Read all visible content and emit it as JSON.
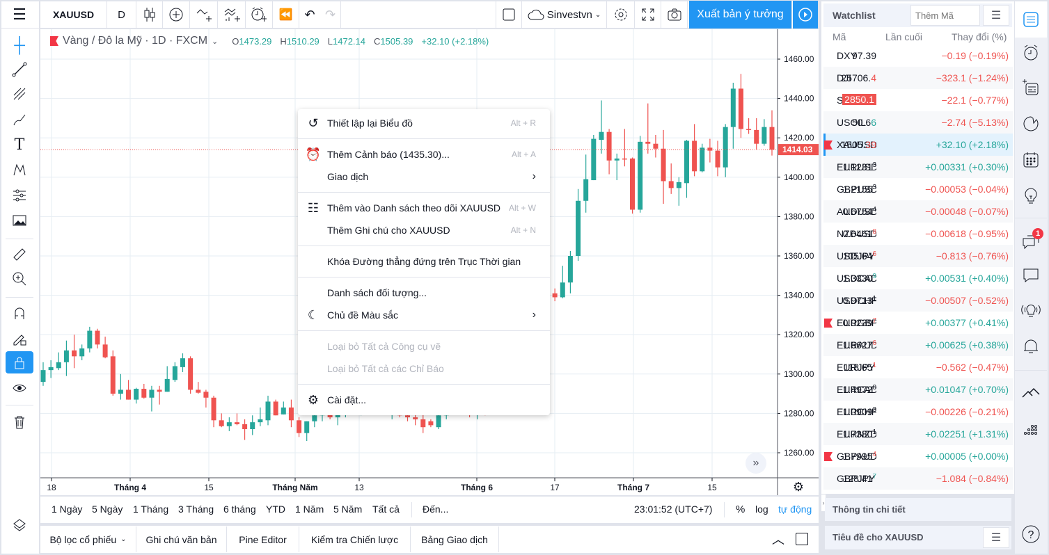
{
  "header": {
    "symbol": "XAUUSD",
    "interval": "D",
    "user": "Sinvestvn",
    "publish_label": "Xuất bản ý tưởng"
  },
  "legend": {
    "title": "Vàng / Đô la Mỹ · 1D · FXCM",
    "o_label": "O",
    "o": "1473.29",
    "h_label": "H",
    "h": "1510.29",
    "l_label": "L",
    "l": "1472.14",
    "c_label": "C",
    "c": "1505.39",
    "change": "+32.10 (+2.18%)"
  },
  "colors": {
    "up": "#26a69a",
    "down": "#ef5350",
    "accent": "#2196f3",
    "grid": "#e6edf3"
  },
  "chart_data": {
    "type": "candlestick",
    "ylim": [
      1250,
      1470
    ],
    "y_ticks": [
      "1460.00",
      "1440.00",
      "1420.00",
      "1400.00",
      "1380.00",
      "1360.00",
      "1340.00",
      "1320.00",
      "1300.00",
      "1280.00",
      "1260.00"
    ],
    "x_ticks": [
      "18",
      "Tháng 4",
      "15",
      "Tháng Năm",
      "13",
      "Tháng 6",
      "17",
      "Tháng 7",
      "15"
    ],
    "last_price_label": "1414.03",
    "grid": true,
    "ohlc": [
      [
        1296,
        1306,
        1294,
        1302
      ],
      [
        1302,
        1307,
        1298,
        1303.5
      ],
      [
        1303,
        1311,
        1302,
        1306
      ],
      [
        1306,
        1317,
        1299,
        1312
      ],
      [
        1312,
        1320,
        1303,
        1309
      ],
      [
        1309,
        1315,
        1307,
        1313
      ],
      [
        1313,
        1324,
        1311,
        1322
      ],
      [
        1322,
        1323,
        1313,
        1315
      ],
      [
        1315,
        1319,
        1308,
        1308.5
      ],
      [
        1309,
        1312,
        1289,
        1290
      ],
      [
        1290,
        1300,
        1287,
        1292
      ],
      [
        1292,
        1297,
        1287,
        1287
      ],
      [
        1287,
        1293,
        1285,
        1292.5
      ],
      [
        1292.5,
        1295,
        1287.5,
        1288
      ],
      [
        1288,
        1294,
        1281,
        1292
      ],
      [
        1292,
        1294,
        1284.5,
        1291
      ],
      [
        1291,
        1304,
        1291,
        1297.5
      ],
      [
        1297,
        1306,
        1296,
        1304
      ],
      [
        1303.5,
        1310.5,
        1301,
        1308
      ],
      [
        1308,
        1309,
        1290,
        1292
      ],
      [
        1292,
        1296,
        1290,
        1290.5
      ],
      [
        1291,
        1292,
        1283,
        1288
      ],
      [
        1288,
        1289,
        1273,
        1276.5
      ],
      [
        1276.5,
        1280,
        1273,
        1273.5
      ],
      [
        1273.5,
        1278,
        1271,
        1275.5
      ],
      [
        1275.5,
        1280,
        1274,
        1274.5
      ],
      [
        1274.5,
        1277,
        1266.5,
        1272
      ],
      [
        1272,
        1279,
        1269,
        1275.5
      ],
      [
        1275.5,
        1283,
        1273.5,
        1277
      ],
      [
        1276.5,
        1289,
        1274,
        1286
      ],
      [
        1286,
        1287,
        1279,
        1279
      ],
      [
        1279.5,
        1286,
        1279.5,
        1283
      ],
      [
        1283,
        1287,
        1273,
        1276.5
      ],
      [
        1276.5,
        1278,
        1268,
        1270
      ],
      [
        1270,
        1276,
        1266,
        1276
      ],
      [
        1276,
        1280,
        1273,
        1279
      ],
      [
        1279,
        1283,
        1276,
        1281
      ],
      [
        1281,
        1285,
        1277,
        1278
      ],
      [
        1278,
        1282,
        1274,
        1280
      ],
      [
        1280,
        1286,
        1278,
        1284
      ],
      [
        1284,
        1288,
        1280,
        1282
      ],
      [
        1282,
        1287,
        1279,
        1286
      ],
      [
        1286,
        1292,
        1283,
        1289
      ],
      [
        1289,
        1293,
        1284,
        1285
      ],
      [
        1285,
        1289,
        1280,
        1281
      ],
      [
        1281,
        1284,
        1277,
        1283
      ],
      [
        1283,
        1286,
        1278,
        1279
      ],
      [
        1279,
        1282,
        1276,
        1278
      ],
      [
        1278,
        1280,
        1274,
        1277
      ],
      [
        1277,
        1282,
        1270,
        1273
      ],
      [
        1276,
        1277,
        1273,
        1274
      ],
      [
        1273,
        1280,
        1272,
        1279
      ],
      [
        1279,
        1285,
        1277,
        1283
      ],
      [
        1283,
        1288,
        1280,
        1286
      ],
      [
        1286,
        1290,
        1282,
        1284
      ],
      [
        1284,
        1287,
        1278,
        1280
      ],
      [
        1280,
        1286,
        1277,
        1284
      ],
      [
        1284,
        1289,
        1279,
        1281
      ],
      [
        1281,
        1290,
        1280,
        1288
      ],
      [
        1288,
        1294,
        1285,
        1292
      ],
      [
        1292,
        1298,
        1289,
        1296
      ],
      [
        1296,
        1305,
        1294,
        1303
      ],
      [
        1303,
        1312,
        1300,
        1309
      ],
      [
        1309,
        1320,
        1306,
        1318
      ],
      [
        1318,
        1330,
        1315,
        1327
      ],
      [
        1327,
        1344,
        1325,
        1341
      ],
      [
        1341,
        1343.5,
        1337,
        1339
      ],
      [
        1339,
        1355,
        1338.5,
        1346.5
      ],
      [
        1346.5,
        1362.5,
        1341,
        1360
      ],
      [
        1360,
        1394,
        1357.5,
        1388
      ],
      [
        1388,
        1411.5,
        1382,
        1399
      ],
      [
        1398.5,
        1421.5,
        1398.5,
        1419.5
      ],
      [
        1419,
        1439,
        1412,
        1423
      ],
      [
        1423,
        1424.5,
        1401.5,
        1408.5
      ],
      [
        1408.5,
        1412,
        1398.5,
        1409.5
      ],
      [
        1409.5,
        1424.5,
        1405.5,
        1409
      ],
      [
        1409.5,
        1410,
        1381.5,
        1383.5
      ],
      [
        1383.5,
        1421,
        1382,
        1418
      ],
      [
        1418,
        1437.5,
        1412,
        1417
      ],
      [
        1417,
        1421.5,
        1410,
        1414.5
      ],
      [
        1414.5,
        1424,
        1386.5,
        1398
      ],
      [
        1398,
        1407,
        1391.5,
        1394.5
      ],
      [
        1394.5,
        1400,
        1385.5,
        1397.5
      ],
      [
        1397,
        1419,
        1389.5,
        1418.5
      ],
      [
        1418.5,
        1427,
        1400.5,
        1403
      ],
      [
        1403,
        1417,
        1402.5,
        1415
      ],
      [
        1415,
        1419.5,
        1407.5,
        1413.5
      ],
      [
        1413.5,
        1418.5,
        1400.5,
        1405
      ],
      [
        1405,
        1427,
        1400,
        1425.5
      ],
      [
        1425.5,
        1448,
        1414.5,
        1445
      ],
      [
        1445,
        1452.5,
        1420,
        1424.5
      ],
      [
        1424.5,
        1430,
        1422,
        1424
      ],
      [
        1424,
        1430,
        1414,
        1417
      ],
      [
        1417,
        1429.5,
        1416,
        1425.5
      ],
      [
        1425.5,
        1434,
        1411,
        1414
      ]
    ]
  },
  "context_menu": [
    {
      "label": "Thiết lập lại Biểu đồ",
      "shortcut": "Alt + R",
      "icon": "reset-icon"
    },
    {
      "label": "Thêm Cảnh báo (1435.30)...",
      "shortcut": "Alt + A",
      "icon": "alarm-add-icon"
    },
    {
      "label": "Giao dịch",
      "submenu": true
    },
    {
      "label": "Thêm vào Danh sách theo dõi XAUUSD",
      "shortcut": "Alt + W",
      "icon": "watchlist-add-icon"
    },
    {
      "label": "Thêm Ghi chú cho XAUUSD",
      "shortcut": "Alt + N"
    },
    {
      "label": "Khóa Đường thẳng đứng trên Trục Thời gian"
    },
    {
      "label": "Danh sách đối tượng..."
    },
    {
      "label": "Chủ đề Màu sắc",
      "submenu": true,
      "icon": "moon-icon"
    },
    {
      "label": "Loại bỏ Tất cả Công cụ vẽ",
      "disabled": true
    },
    {
      "label": "Loại bỏ Tất cả các Chỉ Báo",
      "disabled": true
    },
    {
      "label": "Cài đặt...",
      "icon": "gear-icon"
    }
  ],
  "ranges": [
    "1 Ngày",
    "5 Ngày",
    "1 Tháng",
    "3 Tháng",
    "6 tháng",
    "YTD",
    "1 Năm",
    "5 Năm",
    "Tất cả"
  ],
  "goto_label": "Đến...",
  "clock": "23:01:52 (UTC+7)",
  "scale": {
    "percent": "%",
    "log": "log",
    "auto": "tự động"
  },
  "bottom_tabs": [
    "Bộ lọc cổ phiếu",
    "Ghi chú văn bản",
    "Pine Editor",
    "Kiểm tra Chiến lược",
    "Bảng Giao dịch"
  ],
  "watchlist": {
    "title": "Watchlist",
    "add_placeholder": "Thêm Mã",
    "col_symbol": "Mã",
    "col_last": "Lần cuối",
    "col_change": "Thay đổi (%)",
    "rows": [
      {
        "sym": "DXY",
        "main": "97.39",
        "tail": "",
        "change": "−0.19 (−0.19%)",
        "dir": "down"
      },
      {
        "sym": "DJI",
        "main": "25706.",
        "tail": "4",
        "tail_color": "down",
        "change": "−323.1 (−1.24%)",
        "dir": "down"
      },
      {
        "sym": "SPX500USD",
        "main": "2850.1",
        "tail": "",
        "highlight": true,
        "change": "−22.1 (−0.77%)",
        "dir": "down"
      },
      {
        "sym": "USOIL",
        "main": "50.6",
        "tail": "6",
        "tail_color": "up",
        "change": "−2.74 (−5.13%)",
        "dir": "down"
      },
      {
        "sym": "XAUUSD",
        "main": "1505.",
        "tail": "39",
        "tail_color": "down",
        "change": "+32.10 (+2.18%)",
        "dir": "up",
        "flag": true,
        "selected": true
      },
      {
        "sym": "EURUSD",
        "main": "1.1231",
        "tail": "3",
        "sup": true,
        "change": "+0.00331 (+0.30%)",
        "dir": "up"
      },
      {
        "sym": "GBPUSD",
        "main": "1.2155",
        "tail": "3",
        "sup": true,
        "change": "−0.00053 (−0.04%)",
        "dir": "down"
      },
      {
        "sym": "AUDUSD",
        "main": "0.6754",
        "tail": "4",
        "sup": true,
        "change": "−0.00048 (−0.07%)",
        "dir": "down"
      },
      {
        "sym": "NZDUSD",
        "main": "0.6461",
        "tail": "8",
        "sup": true,
        "tail_color": "down",
        "change": "−0.00618 (−0.95%)",
        "dir": "down"
      },
      {
        "sym": "USDJPY",
        "main": "105.64",
        "tail": "6",
        "sup": true,
        "tail_color": "down",
        "change": "−0.813 (−0.76%)",
        "dir": "down"
      },
      {
        "sym": "USDCAD",
        "main": "1.3330",
        "tail": "9",
        "sup": true,
        "tail_color": "up",
        "change": "+0.00531 (+0.40%)",
        "dir": "up"
      },
      {
        "sym": "USDCHF",
        "main": "0.9713",
        "tail": "1",
        "sup": true,
        "change": "−0.00507 (−0.52%)",
        "dir": "down"
      },
      {
        "sym": "EURGBP",
        "main": "0.9239",
        "tail": "7",
        "sup": true,
        "tail_color": "down",
        "change": "+0.00377 (+0.41%)",
        "dir": "up",
        "flag": true
      },
      {
        "sym": "EURAUD",
        "main": "1.6627",
        "tail": "6",
        "sup": true,
        "tail_color": "down",
        "change": "+0.00625 (+0.38%)",
        "dir": "up"
      },
      {
        "sym": "EURJPY",
        "main": "118.65",
        "tail": "1",
        "sup": true,
        "tail_color": "down",
        "change": "−0.562 (−0.47%)",
        "dir": "down"
      },
      {
        "sym": "EURCAD",
        "main": "1.4972",
        "tail": "0",
        "sup": true,
        "change": "+0.01047 (+0.70%)",
        "dir": "up"
      },
      {
        "sym": "EURCHF",
        "main": "1.0909",
        "tail": "3",
        "sup": true,
        "change": "−0.00226 (−0.21%)",
        "dir": "down"
      },
      {
        "sym": "EURNZD",
        "main": "1.7380",
        "tail": "1",
        "sup": true,
        "change": "+0.02251 (+1.31%)",
        "dir": "up"
      },
      {
        "sym": "GBPAUD",
        "main": "1.7995",
        "tail": "4",
        "sup": true,
        "tail_color": "down",
        "change": "+0.00005 (+0.00%)",
        "dir": "up",
        "flag": true
      },
      {
        "sym": "GBPJPY",
        "main": "128.41",
        "tail": "7",
        "sup": true,
        "tail_color": "up",
        "change": "−1.084 (−0.84%)",
        "dir": "down"
      }
    ],
    "details_title": "Thông tin chi tiết",
    "headlines_title": "Tiêu đề cho XAUUSD"
  },
  "notification_count": "1"
}
